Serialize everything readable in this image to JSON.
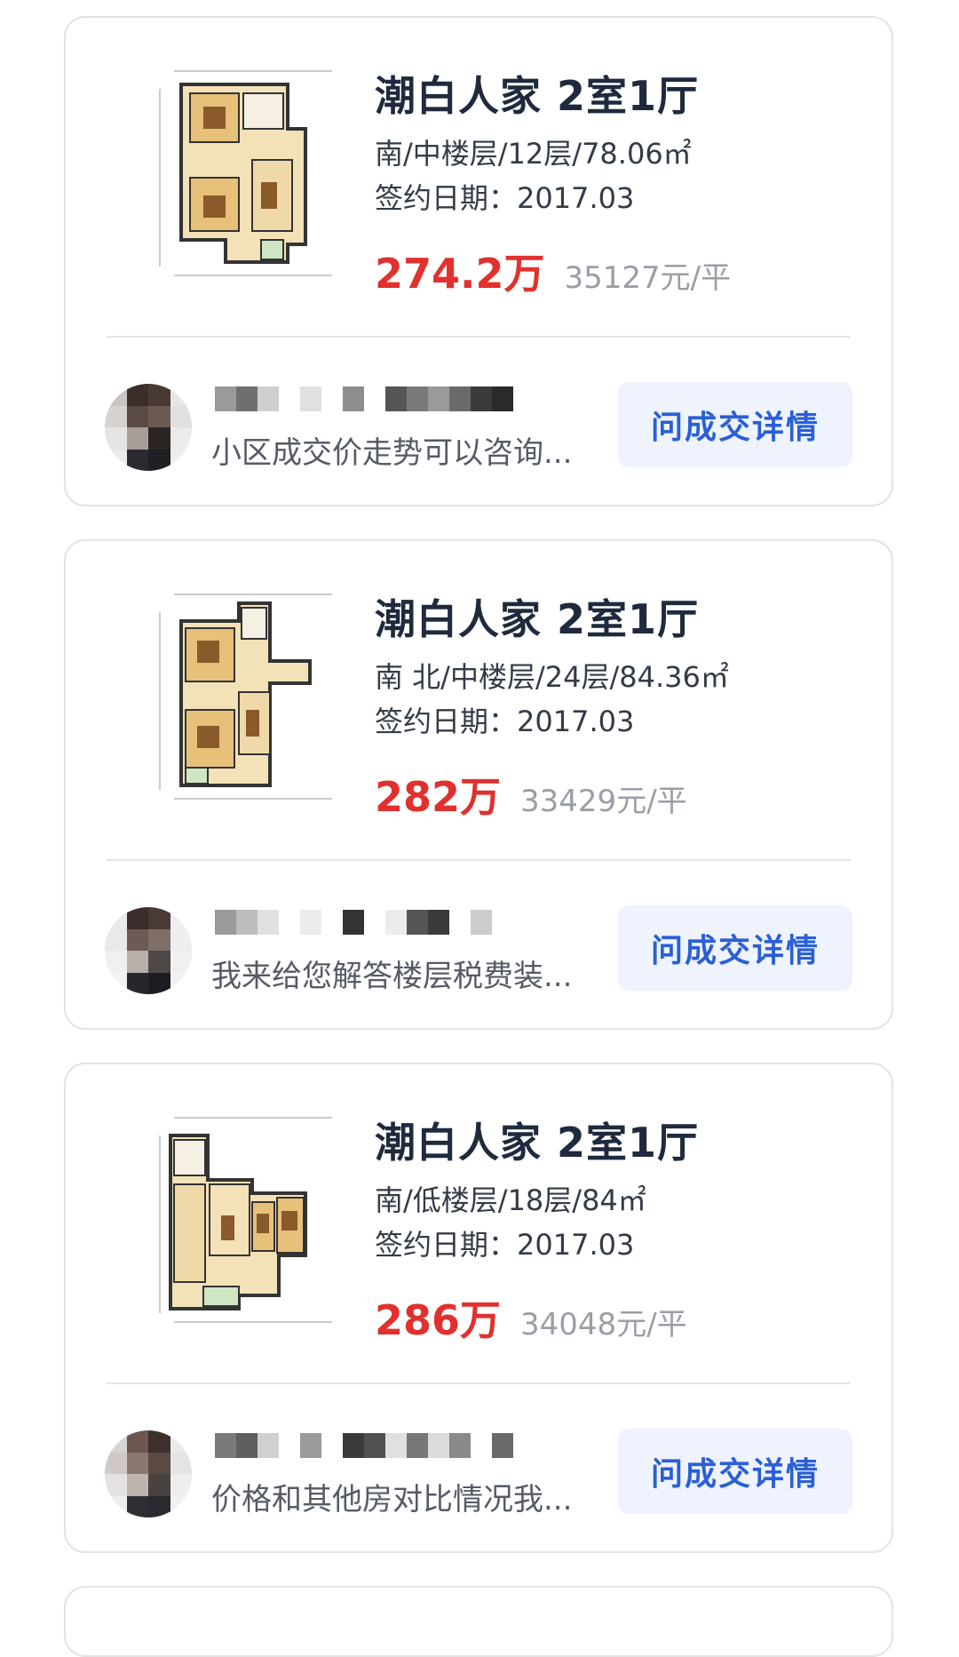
{
  "listings": [
    {
      "title": "潮白人家 2室1厅",
      "meta": "南/中楼层/12层/78.06㎡",
      "date": "签约日期：2017.03",
      "total_price": "274.2万",
      "unit_price": "35127元/平",
      "agent_message": "小区成交价走势可以咨询...",
      "button_label": "问成交详情"
    },
    {
      "title": "潮白人家 2室1厅",
      "meta": "南 北/中楼层/24层/84.36㎡",
      "date": "签约日期：2017.03",
      "total_price": "282万",
      "unit_price": "33429元/平",
      "agent_message": "我来给您解答楼层税费装...",
      "button_label": "问成交详情"
    },
    {
      "title": "潮白人家 2室1厅",
      "meta": "南/低楼层/18层/84㎡",
      "date": "签约日期：2017.03",
      "total_price": "286万",
      "unit_price": "34048元/平",
      "agent_message": "价格和其他房对比情况我...",
      "button_label": "问成交详情"
    }
  ],
  "colors": {
    "price_red": "#e0312f",
    "button_blue": "#2a5fd6",
    "button_bg": "#eef3fd",
    "title": "#1f2a3d"
  }
}
